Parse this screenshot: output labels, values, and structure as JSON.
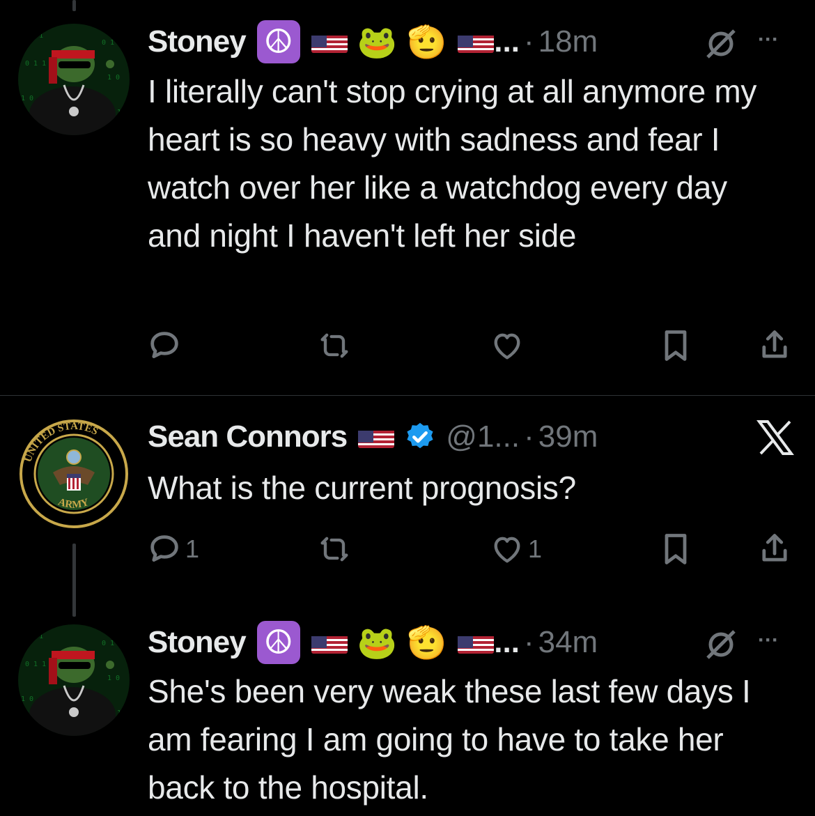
{
  "tweets": [
    {
      "author": "Stoney",
      "author_suffix": "...",
      "handle": "",
      "separator": "·",
      "time": "18m",
      "text": "I literally can't stop crying at all anymore my heart is so heavy with sadness and fear I watch over her like a watchdog every day and night I haven't left her side",
      "replies": "",
      "likes": "",
      "icons": [
        "peace-emoji",
        "us-flag",
        "frog-emoji",
        "saluting-face-emoji",
        "us-flag",
        "grok-slash-icon",
        "more-icon"
      ]
    },
    {
      "author": "Sean Connors",
      "handle": "@1...",
      "separator": "·",
      "time": "39m",
      "text": "What is the current prognosis?",
      "replies": "1",
      "likes": "1",
      "icons": [
        "us-flag",
        "verified-badge-icon",
        "x-logo-icon"
      ]
    },
    {
      "author": "Stoney",
      "author_suffix": "...",
      "handle": "",
      "separator": "·",
      "time": "34m",
      "text": "She's been very weak these last few days I am fearing I am going to have to take her back to the hospital.",
      "replies": "",
      "likes": "",
      "icons": [
        "peace-emoji",
        "us-flag",
        "frog-emoji",
        "saluting-face-emoji",
        "us-flag",
        "grok-slash-icon",
        "more-icon"
      ]
    }
  ],
  "badges": {
    "peace": "☮",
    "frog": "🐸",
    "salute": "🫡",
    "more": "···"
  },
  "colors": {
    "background": "#000000",
    "text": "#e7e9ea",
    "muted": "#71767b",
    "verified": "#1d9bf0",
    "peace_bg": "#9b59d0"
  }
}
